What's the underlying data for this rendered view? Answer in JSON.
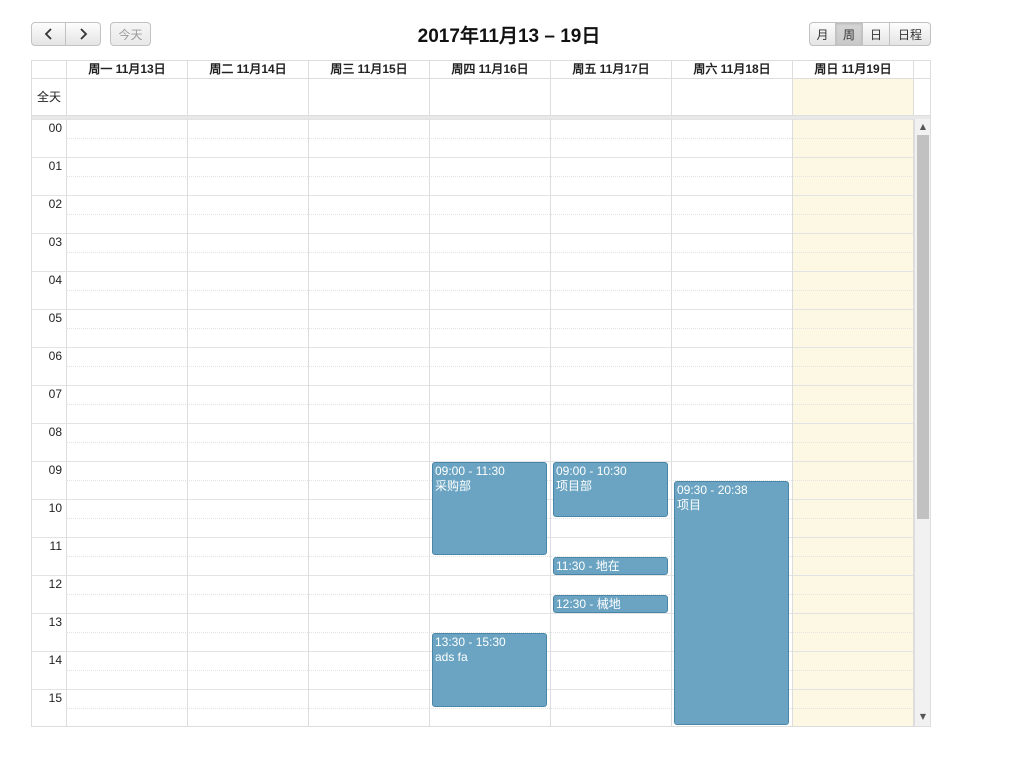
{
  "toolbar": {
    "prev_icon": "chevron-left-icon",
    "next_icon": "chevron-right-icon",
    "today_label": "今天",
    "title": "2017年11月13 – 19日",
    "views": [
      "月",
      "周",
      "日",
      "日程"
    ],
    "active_view": "周"
  },
  "calendar": {
    "days": [
      "周一 11月13日",
      "周二 11月14日",
      "周三 11月15日",
      "周四 11月16日",
      "周五 11月17日",
      "周六 11月18日",
      "周日 11月19日"
    ],
    "today_day": "周日 11月19日",
    "allday_label": "全天",
    "hours": [
      "00",
      "01",
      "02",
      "03",
      "04",
      "05",
      "06",
      "07",
      "08",
      "09",
      "10",
      "11",
      "12",
      "13",
      "14",
      "15"
    ],
    "events": [
      {
        "day": "周四 11月16日",
        "start": "09:00",
        "end": "11:30",
        "time": "09:00 - 11:30",
        "title": "采购部"
      },
      {
        "day": "周四 11月16日",
        "start": "13:30",
        "end": "15:30",
        "time": "13:30 - 15:30",
        "title": "ads fa"
      },
      {
        "day": "周五 11月17日",
        "start": "09:00",
        "end": "10:30",
        "time": "09:00 - 10:30",
        "title": "项目部"
      },
      {
        "day": "周五 11月17日",
        "start": "11:30",
        "end": "12:00",
        "time": "11:30 - 地在",
        "title": ""
      },
      {
        "day": "周五 11月17日",
        "start": "12:30",
        "end": "13:00",
        "time": "12:30 - 械地",
        "title": ""
      },
      {
        "day": "周六 11月18日",
        "start": "09:30",
        "end": "20:38",
        "time": "09:30 - 20:38",
        "title": "项目"
      }
    ]
  },
  "colors": {
    "event_bg": "#6aa4c2",
    "event_border": "#4a86a8",
    "today_bg": "#fcf8e3"
  }
}
